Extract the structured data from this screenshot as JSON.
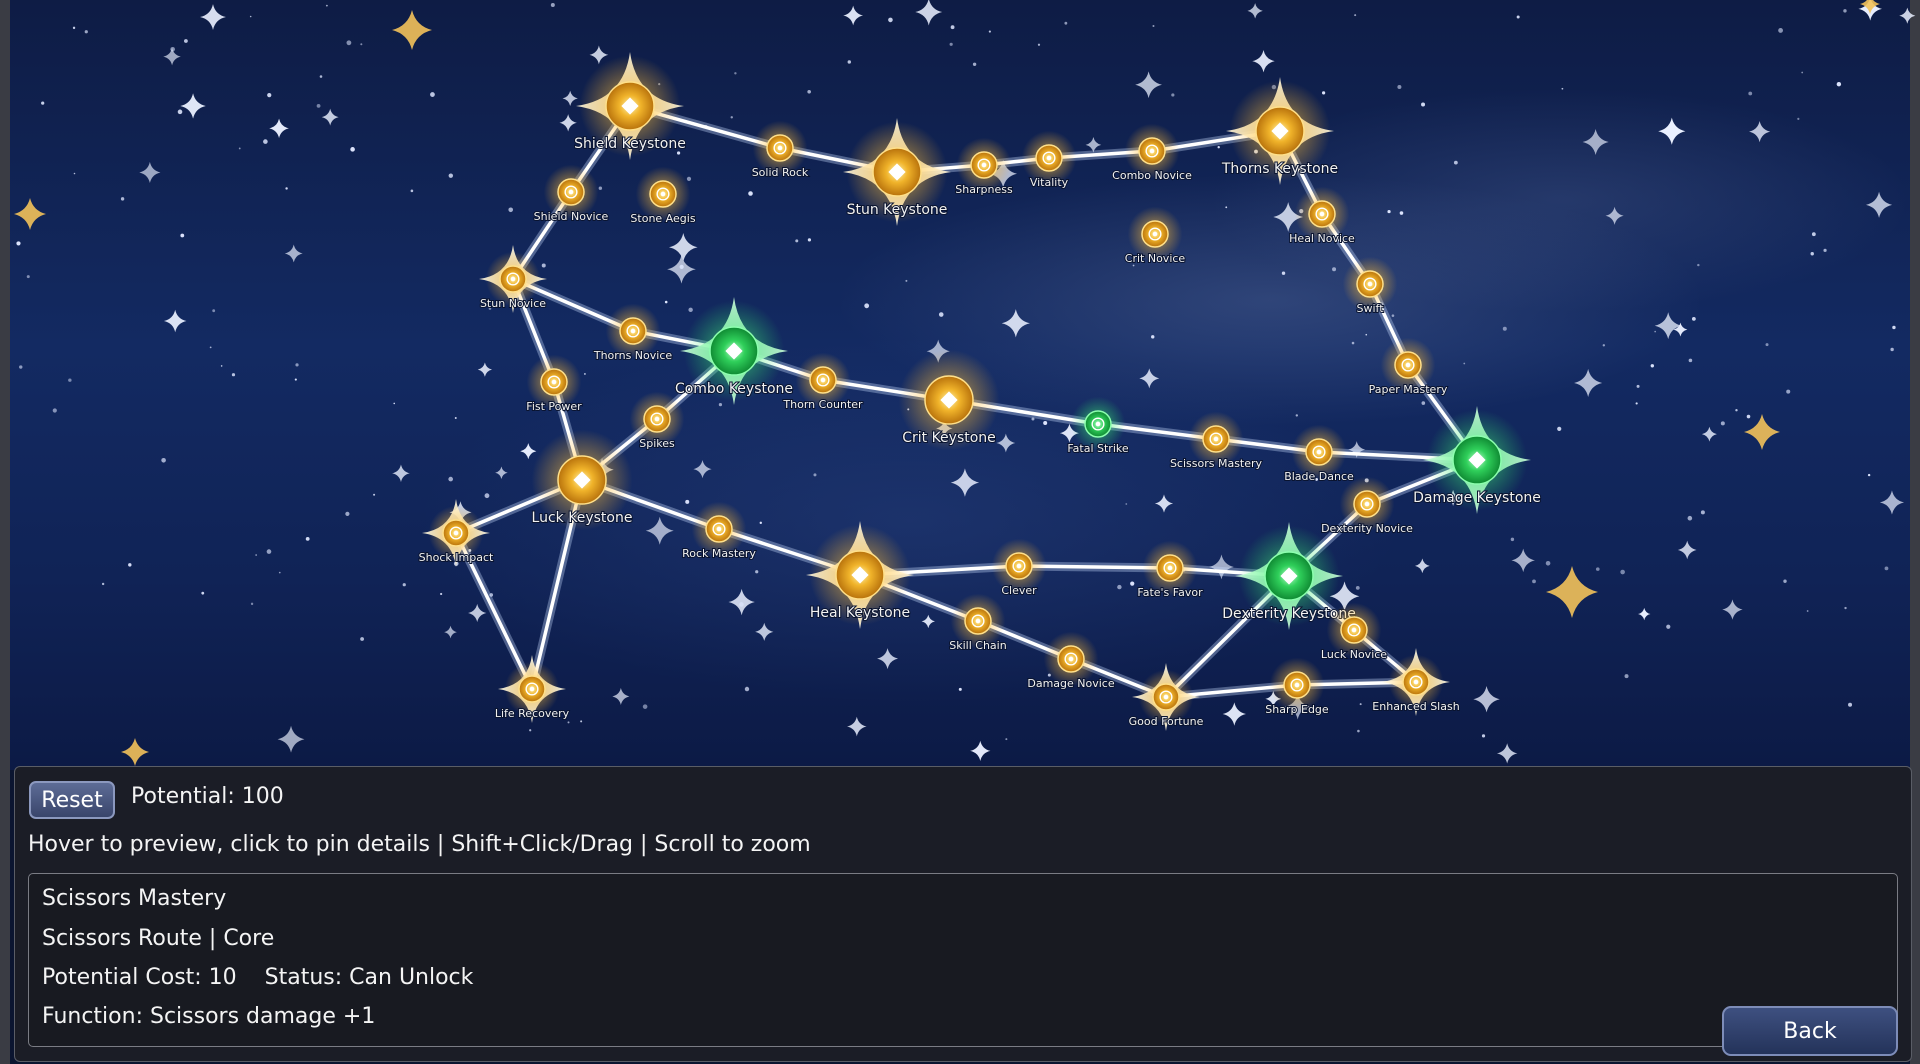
{
  "panel": {
    "reset_label": "Reset",
    "potential_text": "Potential: 100",
    "hint_text": "Hover to preview, click to pin details | Shift+Click/Drag | Scroll to zoom",
    "details": {
      "name": "Scissors Mastery",
      "route": "Scissors Route | Core",
      "cost_status": "Potential Cost: 10    Status: Can Unlock",
      "function": "Function: Scissors damage +1"
    },
    "back_label": "Back"
  },
  "colors": {
    "locked_node": "#e0a020",
    "unlocked_node": "#2ecc55",
    "link": "#ffffff"
  },
  "nodes": [
    {
      "id": "shield_keystone",
      "label": "Shield Keystone",
      "keystone": true,
      "state": "locked"
    },
    {
      "id": "solid_rock",
      "label": "Solid Rock",
      "keystone": false,
      "state": "locked"
    },
    {
      "id": "stun_keystone",
      "label": "Stun Keystone",
      "keystone": true,
      "state": "locked"
    },
    {
      "id": "sharpness",
      "label": "Sharpness",
      "keystone": false,
      "state": "locked"
    },
    {
      "id": "vitality",
      "label": "Vitality",
      "keystone": false,
      "state": "locked"
    },
    {
      "id": "combo_novice",
      "label": "Combo Novice",
      "keystone": false,
      "state": "locked"
    },
    {
      "id": "thorns_keystone",
      "label": "Thorns Keystone",
      "keystone": true,
      "state": "locked"
    },
    {
      "id": "shield_novice",
      "label": "Shield Novice",
      "keystone": false,
      "state": "locked"
    },
    {
      "id": "stone_aegis",
      "label": "Stone Aegis",
      "keystone": false,
      "state": "locked"
    },
    {
      "id": "crit_novice",
      "label": "Crit Novice",
      "keystone": false,
      "state": "locked"
    },
    {
      "id": "heal_novice",
      "label": "Heal Novice",
      "keystone": false,
      "state": "locked"
    },
    {
      "id": "stun_novice",
      "label": "Stun Novice",
      "keystone": false,
      "state": "locked"
    },
    {
      "id": "swift",
      "label": "Swift",
      "keystone": false,
      "state": "locked"
    },
    {
      "id": "thorns_novice",
      "label": "Thorns Novice",
      "keystone": false,
      "state": "locked"
    },
    {
      "id": "combo_keystone",
      "label": "Combo Keystone",
      "keystone": true,
      "state": "unlocked"
    },
    {
      "id": "paper_mastery",
      "label": "Paper Mastery",
      "keystone": false,
      "state": "locked"
    },
    {
      "id": "fist_power",
      "label": "Fist Power",
      "keystone": false,
      "state": "locked"
    },
    {
      "id": "thorn_counter",
      "label": "Thorn Counter",
      "keystone": false,
      "state": "locked"
    },
    {
      "id": "crit_keystone",
      "label": "Crit Keystone",
      "keystone": true,
      "state": "locked"
    },
    {
      "id": "spikes",
      "label": "Spikes",
      "keystone": false,
      "state": "locked"
    },
    {
      "id": "fatal_strike",
      "label": "Fatal Strike",
      "keystone": false,
      "state": "unlocked"
    },
    {
      "id": "scissors_mastery",
      "label": "Scissors Mastery",
      "keystone": false,
      "state": "locked"
    },
    {
      "id": "blade_dance",
      "label": "Blade Dance",
      "keystone": false,
      "state": "locked"
    },
    {
      "id": "damage_keystone",
      "label": "Damage Keystone",
      "keystone": true,
      "state": "unlocked"
    },
    {
      "id": "luck_keystone",
      "label": "Luck Keystone",
      "keystone": true,
      "state": "locked"
    },
    {
      "id": "dexterity_novice",
      "label": "Dexterity Novice",
      "keystone": false,
      "state": "locked"
    },
    {
      "id": "shock_impact",
      "label": "Shock Impact",
      "keystone": false,
      "state": "locked"
    },
    {
      "id": "rock_mastery",
      "label": "Rock Mastery",
      "keystone": false,
      "state": "locked"
    },
    {
      "id": "heal_keystone",
      "label": "Heal Keystone",
      "keystone": true,
      "state": "locked"
    },
    {
      "id": "clever",
      "label": "Clever",
      "keystone": false,
      "state": "locked"
    },
    {
      "id": "fates_favor",
      "label": "Fate's Favor",
      "keystone": false,
      "state": "locked"
    },
    {
      "id": "dexterity_keystone",
      "label": "Dexterity Keystone",
      "keystone": true,
      "state": "unlocked"
    },
    {
      "id": "skill_chain",
      "label": "Skill Chain",
      "keystone": false,
      "state": "locked"
    },
    {
      "id": "luck_novice",
      "label": "Luck Novice",
      "keystone": false,
      "state": "locked"
    },
    {
      "id": "damage_novice",
      "label": "Damage Novice",
      "keystone": false,
      "state": "locked"
    },
    {
      "id": "good_fortune",
      "label": "Good Fortune",
      "keystone": false,
      "state": "locked"
    },
    {
      "id": "sharp_edge",
      "label": "Sharp Edge",
      "keystone": false,
      "state": "locked"
    },
    {
      "id": "enhanced_slash",
      "label": "Enhanced Slash",
      "keystone": false,
      "state": "locked"
    },
    {
      "id": "life_recovery",
      "label": "Life Recovery",
      "keystone": false,
      "state": "locked"
    }
  ],
  "links": [
    [
      "shield_keystone",
      "solid_rock"
    ],
    [
      "solid_rock",
      "stun_keystone"
    ],
    [
      "stun_keystone",
      "sharpness"
    ],
    [
      "sharpness",
      "vitality"
    ],
    [
      "vitality",
      "combo_novice"
    ],
    [
      "combo_novice",
      "thorns_keystone"
    ],
    [
      "thorns_keystone",
      "heal_novice"
    ],
    [
      "heal_novice",
      "swift"
    ],
    [
      "swift",
      "paper_mastery"
    ],
    [
      "paper_mastery",
      "damage_keystone"
    ],
    [
      "shield_keystone",
      "shield_novice"
    ],
    [
      "shield_novice",
      "stun_novice"
    ],
    [
      "stun_novice",
      "thorns_novice"
    ],
    [
      "thorns_novice",
      "combo_keystone"
    ],
    [
      "stun_novice",
      "fist_power"
    ],
    [
      "fist_power",
      "luck_keystone"
    ],
    [
      "combo_keystone",
      "spikes"
    ],
    [
      "spikes",
      "luck_keystone"
    ],
    [
      "combo_keystone",
      "thorn_counter"
    ],
    [
      "thorn_counter",
      "crit_keystone"
    ],
    [
      "crit_keystone",
      "fatal_strike"
    ],
    [
      "fatal_strike",
      "scissors_mastery"
    ],
    [
      "scissors_mastery",
      "blade_dance"
    ],
    [
      "blade_dance",
      "damage_keystone"
    ],
    [
      "luck_keystone",
      "shock_impact"
    ],
    [
      "luck_keystone",
      "rock_mastery"
    ],
    [
      "rock_mastery",
      "heal_keystone"
    ],
    [
      "shock_impact",
      "life_recovery"
    ],
    [
      "luck_keystone",
      "life_recovery"
    ],
    [
      "heal_keystone",
      "clever"
    ],
    [
      "clever",
      "fates_favor"
    ],
    [
      "fates_favor",
      "dexterity_keystone"
    ],
    [
      "dexterity_keystone",
      "dexterity_novice"
    ],
    [
      "dexterity_novice",
      "damage_keystone"
    ],
    [
      "heal_keystone",
      "skill_chain"
    ],
    [
      "skill_chain",
      "damage_novice"
    ],
    [
      "damage_novice",
      "good_fortune"
    ],
    [
      "dexterity_keystone",
      "good_fortune"
    ],
    [
      "dexterity_keystone",
      "luck_novice"
    ],
    [
      "luck_novice",
      "enhanced_slash"
    ],
    [
      "good_fortune",
      "sharp_edge"
    ],
    [
      "sharp_edge",
      "enhanced_slash"
    ]
  ]
}
